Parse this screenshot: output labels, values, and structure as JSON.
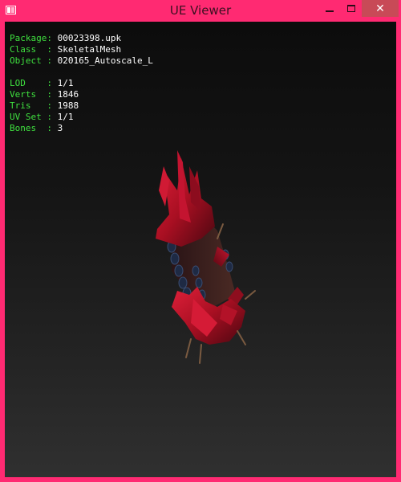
{
  "window": {
    "title": "UE Viewer",
    "controls": {
      "minimize": "minimize",
      "maximize": "maximize",
      "close": "close"
    },
    "accent_color": "#ff2a72",
    "close_hover_color": "#c84a57"
  },
  "info": {
    "package_label": "Package: ",
    "package_value": "00023398.upk",
    "class_label": "Class  : ",
    "class_value": "SkeletalMesh",
    "object_label": "Object : ",
    "object_value": "020165_Autoscale_L",
    "lod_label": "LOD    : ",
    "lod_value": "1/1",
    "verts_label": "Verts  : ",
    "verts_value": "1846",
    "tris_label": "Tris   : ",
    "tris_value": "1988",
    "uvset_label": "UV Set : ",
    "uvset_value": "1/1",
    "bones_label": "Bones  : ",
    "bones_value": "3",
    "label_color": "#3fe03f",
    "value_color": "#ffffff"
  },
  "viewport": {
    "background_top": "#0c0c0c",
    "background_bottom": "#303030",
    "model": "red-spiked-armor-mesh"
  }
}
